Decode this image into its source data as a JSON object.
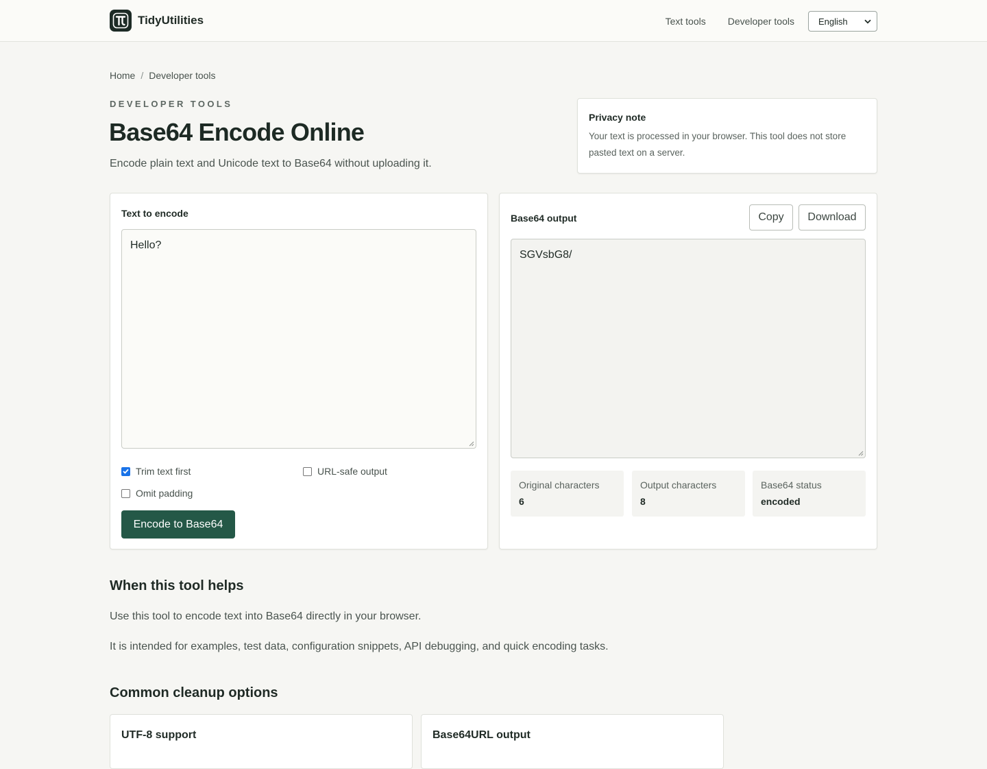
{
  "header": {
    "brand_name": "TidyUtilities",
    "nav": [
      "Text tools",
      "Developer tools"
    ],
    "language": "English"
  },
  "breadcrumb": [
    "Home",
    "Developer tools"
  ],
  "hero": {
    "eyebrow": "DEVELOPER TOOLS",
    "title": "Base64 Encode Online",
    "subtitle": "Encode plain text and Unicode text to Base64 without uploading it."
  },
  "privacy": {
    "title": "Privacy note",
    "text": "Your text is processed in your browser. This tool does not store pasted text on a server."
  },
  "input_panel": {
    "label": "Text to encode",
    "value": "Hello?",
    "options": [
      {
        "label": "Trim text first",
        "checked": true
      },
      {
        "label": "URL-safe output",
        "checked": false
      },
      {
        "label": "Omit padding",
        "checked": false
      }
    ],
    "encode_button": "Encode to Base64"
  },
  "output_panel": {
    "label": "Base64 output",
    "copy_button": "Copy",
    "download_button": "Download",
    "value": "SGVsbG8/",
    "stats": [
      {
        "label": "Original characters",
        "value": "6"
      },
      {
        "label": "Output characters",
        "value": "8"
      },
      {
        "label": "Base64 status",
        "value": "encoded"
      }
    ]
  },
  "help": {
    "title": "When this tool helps",
    "paragraphs": [
      "Use this tool to encode text into Base64 directly in your browser.",
      "It is intended for examples, test data, configuration snippets, API debugging, and quick encoding tasks."
    ]
  },
  "options_section": {
    "title": "Common cleanup options",
    "cards": [
      "UTF-8 support",
      "Base64URL output"
    ]
  },
  "colors": {
    "accent": "#245847",
    "background": "#f6f6f3",
    "checkbox": "#1a73e8"
  }
}
